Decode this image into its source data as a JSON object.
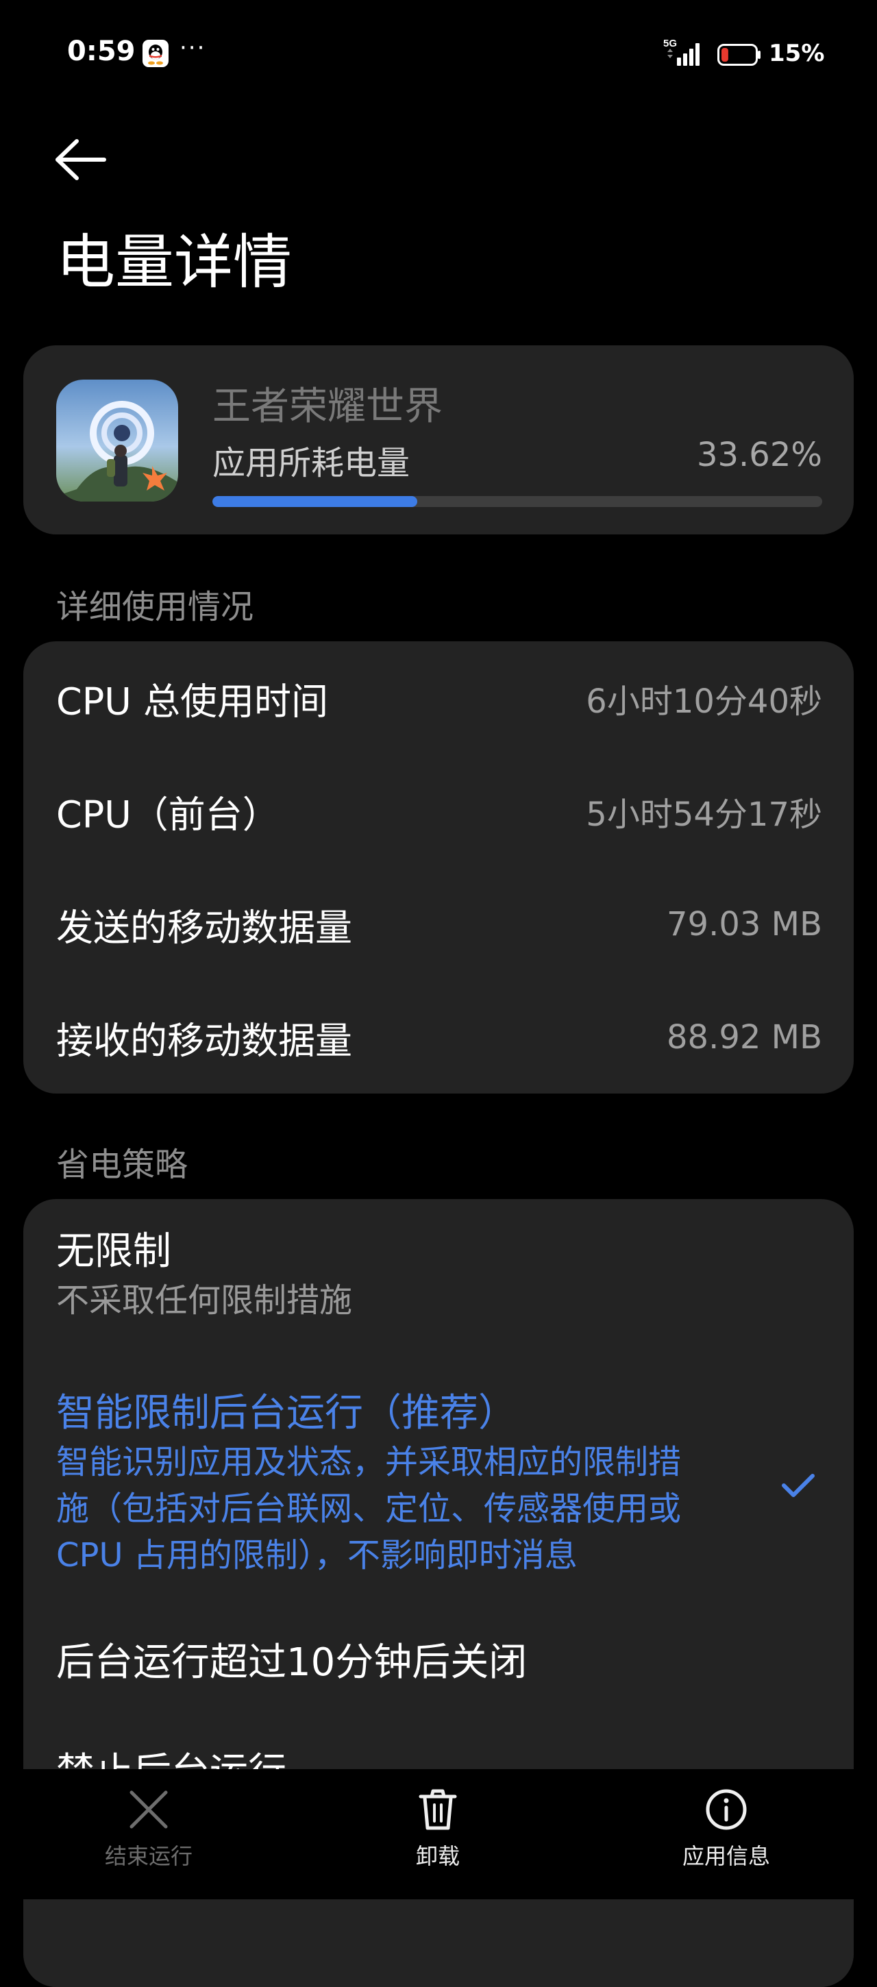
{
  "status_bar": {
    "time": "0:59",
    "notification_icons": [
      "qq-icon",
      "more-dots-icon"
    ],
    "network": "5G",
    "battery_percent": "15%",
    "battery_level": 0.15
  },
  "header": {
    "back_icon": "arrow-left-icon",
    "title": "电量详情"
  },
  "app_card": {
    "icon": "app-icon",
    "app_name": "王者荣耀世界",
    "usage_label": "应用所耗电量",
    "usage_value": "33.62%",
    "usage_fraction": 0.3362
  },
  "details": {
    "section_label": "详细使用情况",
    "rows": [
      {
        "label": "CPU 总使用时间",
        "value": "6小时10分40秒"
      },
      {
        "label": "CPU（前台）",
        "value": "5小时54分17秒"
      },
      {
        "label": "发送的移动数据量",
        "value": "79.03 MB"
      },
      {
        "label": "接收的移动数据量",
        "value": "88.92 MB"
      }
    ]
  },
  "policy": {
    "section_label": "省电策略",
    "options": [
      {
        "title": "无限制",
        "description": "不采取任何限制措施",
        "selected": false
      },
      {
        "title": "智能限制后台运行（推荐）",
        "description_lines": [
          "智能识别应用及状态，并采取相应的限制措",
          "施（包括对后台联网、定位、传感器使用或",
          "CPU 占用的限制），不影响即时消息"
        ],
        "selected": true
      },
      {
        "title": "后台运行超过10分钟后关闭",
        "description": "",
        "selected": false
      },
      {
        "title": "禁止后台运行",
        "description": "",
        "selected": false
      }
    ]
  },
  "colors": {
    "accent": "#4a82e8",
    "card_bg": "#232323",
    "page_bg": "#000000"
  },
  "bottom_bar": {
    "actions": [
      {
        "icon": "close-icon",
        "label": "结束运行",
        "enabled": false
      },
      {
        "icon": "trash-icon",
        "label": "卸载",
        "enabled": true
      },
      {
        "icon": "info-icon",
        "label": "应用信息",
        "enabled": true
      }
    ]
  }
}
